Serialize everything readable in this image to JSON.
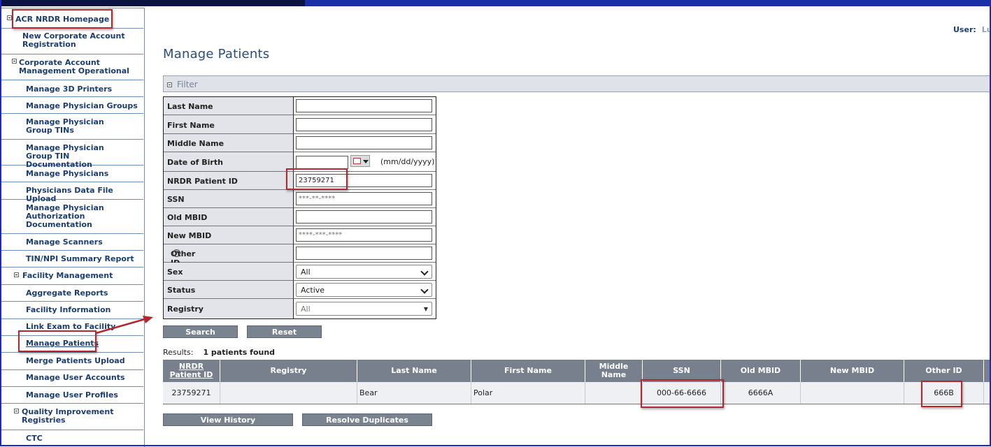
{
  "header": {
    "user_label": "User:",
    "user_value": "Lu"
  },
  "sidebar": {
    "home": "ACR NRDR Homepage",
    "items": [
      "New Corporate Account Registration",
      "Corporate Account Management Operational",
      "Manage 3D Printers",
      "Manage Physician Groups",
      "Manage Physician Group TINs",
      "Manage Physician Group TIN Documentation",
      "Manage Physicians",
      "Physicians Data File Upload",
      "Manage Physician Authorization Documentation",
      "Manage Scanners",
      "TIN/NPI Summary Report",
      "Facility Management",
      "Aggregate Reports",
      "Facility Information",
      "Link Exam to Facility",
      "Manage Patients",
      "Merge Patients Upload",
      "Manage User Accounts",
      "Manage User Profiles",
      "Quality Improvement Registries",
      "CTC"
    ]
  },
  "page": {
    "title": "Manage Patients"
  },
  "filter": {
    "section_label": "Filter",
    "fields": {
      "last_name": {
        "label": "Last Name",
        "value": ""
      },
      "first_name": {
        "label": "First Name",
        "value": ""
      },
      "middle_name": {
        "label": "Middle Name",
        "value": ""
      },
      "dob": {
        "label": "Date of Birth",
        "value": "",
        "format_hint": "(mm/dd/yyyy)"
      },
      "nrdr_id": {
        "label": "NRDR Patient ID",
        "value": "23759271"
      },
      "ssn": {
        "label": "SSN",
        "placeholder": "***-**-****"
      },
      "old_mbid": {
        "label": "Old MBID",
        "value": ""
      },
      "new_mbid": {
        "label": "New MBID",
        "placeholder": "****-***-****"
      },
      "other_id": {
        "label": "Other ID",
        "value": ""
      },
      "sex": {
        "label": "Sex",
        "value": "All"
      },
      "status": {
        "label": "Status",
        "value": "Active"
      },
      "registry": {
        "label": "Registry",
        "value": "All"
      }
    },
    "search_label": "Search",
    "reset_label": "Reset"
  },
  "results": {
    "label": "Results:",
    "summary": "1 patients found",
    "columns": [
      "NRDR Patient ID",
      "Registry",
      "Last Name",
      "First Name",
      "Middle Name",
      "SSN",
      "Old MBID",
      "New MBID",
      "Other ID"
    ],
    "rows": [
      {
        "nrdr_id": "23759271",
        "registry": "",
        "last_name": "Bear",
        "first_name": "Polar",
        "middle_name": "",
        "ssn": "000-66-6666",
        "old_mbid": "6666A",
        "new_mbid": "",
        "other_id": "666B"
      }
    ]
  },
  "actions": {
    "view_history": "View History",
    "resolve_duplicates": "Resolve Duplicates"
  },
  "colors": {
    "highlight": "#b3282d",
    "header_blue": "#1b3d73",
    "table_header": "#77808c"
  }
}
